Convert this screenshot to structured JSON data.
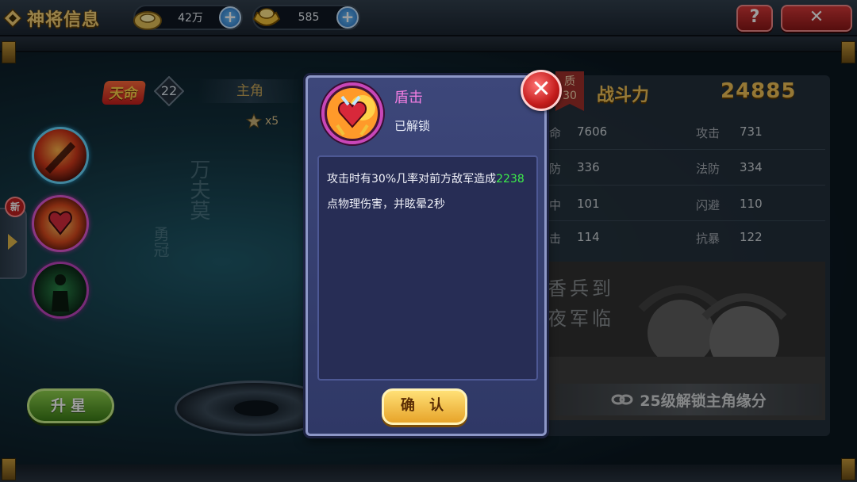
{
  "topbar": {
    "title": "神将信息",
    "resources": [
      {
        "name": "silver",
        "value": "42万"
      },
      {
        "name": "gold_ingot",
        "value": "585"
      }
    ],
    "help_label": "?",
    "close_label": "✕"
  },
  "hero": {
    "tianming_label": "天命",
    "level": "22",
    "role_label": "主角",
    "stars": "x5",
    "new_badge": "新",
    "upstar_label": "升星",
    "calligraphy": [
      "万夫莫",
      "勇冠"
    ]
  },
  "stats_panel": {
    "quality_label": "质",
    "quality_value": "30",
    "power_label": "战斗力",
    "power_value": "24885",
    "rows": [
      {
        "left_label": "命",
        "left_value": "7606",
        "right_label": "攻击",
        "right_value": "731"
      },
      {
        "left_label": "防",
        "left_value": "336",
        "right_label": "法防",
        "right_value": "334"
      },
      {
        "left_label": "中",
        "left_value": "101",
        "right_label": "闪避",
        "right_value": "110"
      },
      {
        "left_label": "击",
        "left_value": "114",
        "right_label": "抗暴",
        "right_value": "122"
      }
    ],
    "fate_poem": [
      "香兵到",
      "夜军临"
    ],
    "lock_text": "25级解锁主角缘分"
  },
  "skill_popup": {
    "name": "盾击",
    "status": "已解锁",
    "desc_prefix": "攻击时有30%几率对前方敌军造成",
    "desc_damage": "2238",
    "desc_suffix": "点物理伤害，并眩晕2秒",
    "confirm_label": "确 认",
    "close_label": "✕"
  },
  "colors": {
    "accent_gold": "#f0c258",
    "skill_title": "#f07de0",
    "damage_green": "#3dee4a",
    "modal_bg": "#3d477a"
  }
}
